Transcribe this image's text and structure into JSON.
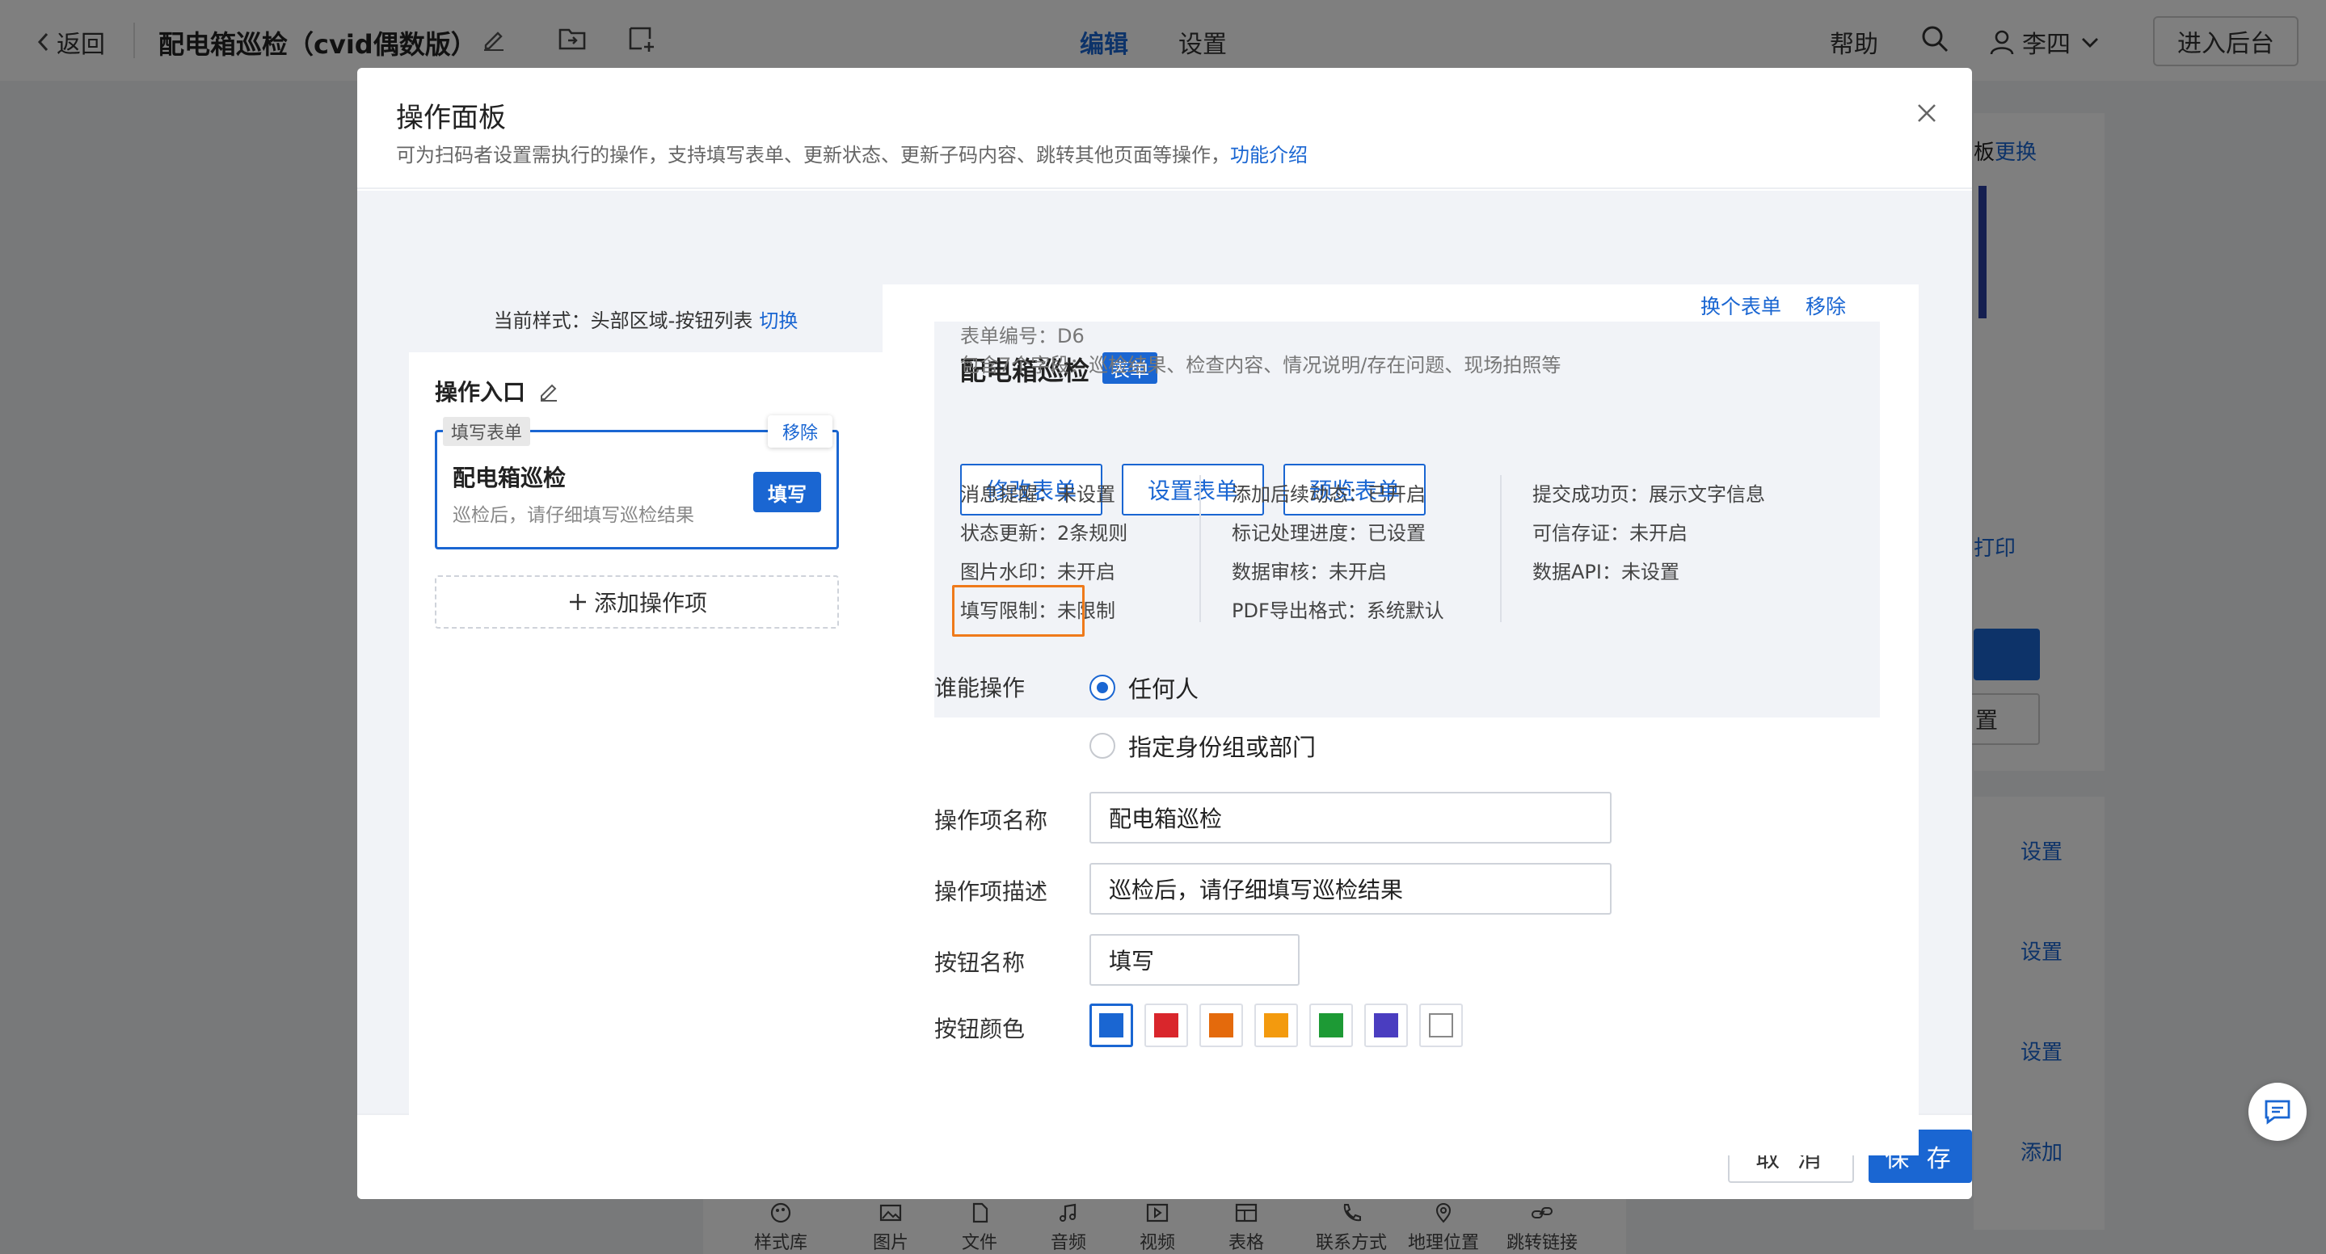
{
  "topbar": {
    "back_label": "返回",
    "app_title": "配电箱巡检（cvid偶数版）",
    "tabs": [
      {
        "label": "编辑",
        "active": true
      },
      {
        "label": "设置",
        "active": false
      }
    ],
    "help_label": "帮助",
    "user_name": "李四",
    "enter_backend_label": "进入后台"
  },
  "background": {
    "right_top_partial": "板",
    "right_top_link": "更换",
    "right_print_partial": "打印",
    "right_outline_btn_partial": "置",
    "settings_links": [
      "设置",
      "设置",
      "设置",
      "添加"
    ],
    "bottom_tools": [
      "样式库",
      "图片",
      "文件",
      "音频",
      "视频",
      "表格",
      "联系方式",
      "地理位置",
      "跳转链接"
    ]
  },
  "modal": {
    "title": "操作面板",
    "subtitle": "可为扫码者设置需执行的操作，支持填写表单、更新状态、更新子码内容、跳转其他页面等操作，",
    "subtitle_link": "功能介绍",
    "cancel_label": "取 消",
    "save_label": "保 存"
  },
  "left_panel": {
    "style_prefix": "当前样式：头部区域-按钮列表",
    "style_switch": "切换",
    "entry_title": "操作入口",
    "entry": {
      "tag": "填写表单",
      "remove_label": "移除",
      "name": "配电箱巡检",
      "desc": "巡检后，请仔细填写巡检结果",
      "button_label": "填写"
    },
    "add_label": "添加操作项"
  },
  "form_card": {
    "name": "配电箱巡检",
    "badge": "表单",
    "change_link": "换个表单",
    "remove_link": "移除",
    "number_text": "表单编号：D6",
    "fields_text": "包含7个字段：巡检结果、检查内容、情况说明/存在问题、现场拍照等",
    "buttons": [
      "修改表单",
      "设置表单",
      "预览表单"
    ],
    "col1": [
      "消息提醒：未设置",
      "状态更新：2条规则",
      "图片水印：未开启",
      "填写限制：未限制"
    ],
    "col2": [
      "添加后续动态：已开启",
      "标记处理进度：已设置",
      "数据审核：未开启",
      "PDF导出格式：系统默认"
    ],
    "col3": [
      "提交成功页：展示文字信息",
      "可信存证：未开启",
      "数据API：未设置"
    ],
    "highlight_color": "#ef7a1a"
  },
  "settings_form": {
    "who_label": "谁能操作",
    "options": [
      {
        "label": "任何人",
        "checked": true
      },
      {
        "label": "指定身份组或部门",
        "checked": false
      }
    ],
    "name_label": "操作项名称",
    "name_value": "配电箱巡检",
    "desc_label": "操作项描述",
    "desc_value": "巡检后，请仔细填写巡检结果",
    "btn_name_label": "按钮名称",
    "btn_name_value": "填写",
    "btn_color_label": "按钮颜色",
    "colors": [
      "#1a66d2",
      "#d9262c",
      "#e46a0c",
      "#f39a0e",
      "#1d9a35",
      "#4a3dc0",
      "#ffffff"
    ],
    "selected_color_index": 0
  },
  "colors": {
    "accent": "#1a66d2"
  }
}
